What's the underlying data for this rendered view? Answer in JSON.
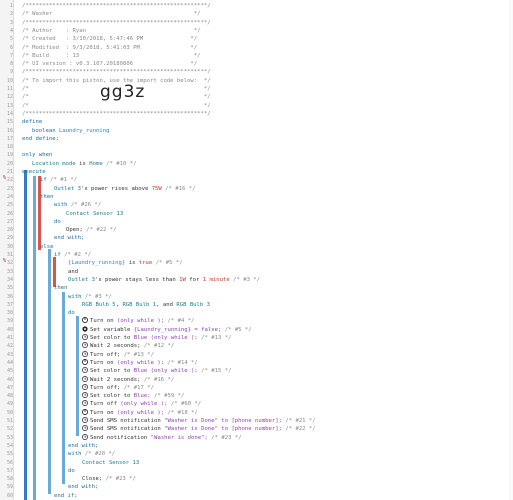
{
  "header": {
    "stars": "/******************************************************/",
    "title": "/* Washer                                          */",
    "author": "/* Author    : Ryan                                */",
    "created": "/* Created   : 3/10/2018, 5:47:46 PM              */",
    "modified": "/* Modified  : 9/3/2018, 5:41:03 PM               */",
    "build": "/* Build     : 13                                  */",
    "ui": "/* UI version : v0.3.107.20180806                 */",
    "import1": "/* To import this piston, use the import code below:  */",
    "blank": "/*                                                    */",
    "code": "gg3z"
  },
  "define": {
    "kw": "define",
    "type": "boolean",
    "var": "Laundry_running",
    "end": "end define;"
  },
  "only": {
    "kw": "only when",
    "cond_a": "Location mode",
    "cond_b": "is",
    "cond_c": "Home",
    "cond_c2": "/* #10 */"
  },
  "exec": {
    "execute": "execute",
    "if": "if",
    "if_c": "/* #1 */",
    "outlet": "Outlet 3",
    "power_rises": "'s power rises above",
    "watts": "75W",
    "cmt1": "/* #16 */",
    "then": "then",
    "with": "with",
    "with_c": "/* #26 */",
    "sensor": "Contact Sensor 13",
    "do": "do",
    "open": "Open;",
    "open_c": "/* #22 */",
    "endwith": "end with;",
    "else": "else",
    "if2": "if",
    "if2_c": "/* #2 */",
    "lr": "{Laundry_running}",
    "is": "is",
    "true": "true",
    "cmt_5": "/* #5 */",
    "and": "and",
    "stays": "'s power stays less than",
    "w1": "1W",
    "for": "for",
    "min": "1 minute",
    "cmt_3": "/* #3 */",
    "then2": "then",
    "with3": "with",
    "with3_c": "/* #3 */",
    "bulbs1": "RGB Bulb 5",
    "bulbs2": "RGB Bulb 1",
    "bulbs3": "RGB Bulb 3",
    "comma": ",",
    "and2": ", and",
    "do2": "do"
  },
  "actions": [
    {
      "icon": "power",
      "t": "Turn on",
      "p": "(only while );",
      "c": "/* #4 */"
    },
    {
      "icon": "gear",
      "t": "Set variable",
      "p": "{Laundry_running} = false;",
      "c": "/* #5 */"
    },
    {
      "icon": "clock",
      "t": "Set color to",
      "p": "Blue (only while );",
      "c": "/* #13 */"
    },
    {
      "icon": "clock",
      "t": "Wait 2 seconds;",
      "p": "",
      "c": "/* #12 */"
    },
    {
      "icon": "clock",
      "t": "Turn off;",
      "p": "",
      "c": "/* #13 */"
    },
    {
      "icon": "power",
      "t": "Turn on",
      "p": "(only while );",
      "c": "/* #14 */"
    },
    {
      "icon": "clock",
      "t": "Set color to",
      "p": "Blue (only while );",
      "c": "/* #15 */"
    },
    {
      "icon": "clock",
      "t": "Wait 2 seconds;",
      "p": "",
      "c": "/* #16 */"
    },
    {
      "icon": "clock",
      "t": "Turn off;",
      "p": "",
      "c": "/* #17 */"
    },
    {
      "icon": "clock",
      "t": "Set color to",
      "p": "Blue;",
      "c": "/* #59 */"
    },
    {
      "icon": "clock",
      "t": "Turn off",
      "p": "(only while );",
      "c": "/* #60 */"
    },
    {
      "icon": "power",
      "t": "Turn on",
      "p": "(only while );",
      "c": "/* #18 */"
    },
    {
      "icon": "clock",
      "t": "Send SMS notification",
      "p": "\"Washer is Done\" to [phone number];",
      "c": "/* #21 */"
    },
    {
      "icon": "clock",
      "t": "Send SMS notification",
      "p": "\"Washer is Done\" to [phone number];",
      "c": "/* #22 */"
    },
    {
      "icon": "clock",
      "t": "Send notification",
      "p": "\"Washer is done\";",
      "c": "/* #23 */"
    }
  ],
  "tail": {
    "endwith": "end with;",
    "with": "with",
    "with_c": "/* #20 */",
    "sensor": "Contact Sensor 13",
    "do": "do",
    "close": "Close;",
    "close_c": "/* #23 */",
    "endwith2": "end with;",
    "endif": "end if;",
    "endif2": "end if;",
    "endexec": "end execute;"
  },
  "lines": [
    "1",
    "2",
    "3",
    "4",
    "5",
    "6",
    "7",
    "8",
    "9",
    "10",
    "11",
    "12",
    "13",
    "14",
    "15",
    "16",
    "17",
    "18",
    "19",
    "20",
    "21",
    "22",
    "23",
    "24",
    "25",
    "26",
    "27",
    "28",
    "29",
    "30",
    "31",
    "32",
    "33",
    "34",
    "35",
    "36",
    "37",
    "38",
    "39",
    "40",
    "41",
    "42",
    "43",
    "44",
    "45",
    "46",
    "47",
    "48",
    "49",
    "50",
    "51",
    "52",
    "53",
    "54",
    "55",
    "56",
    "57",
    "58",
    "59",
    "60"
  ],
  "markers": {
    "m24": "%",
    "m35": "%"
  },
  "colors": {
    "blue_bar": "#2f7fc1",
    "red_bar": "#d9534f",
    "mid_bar": "#6aa9d8"
  }
}
